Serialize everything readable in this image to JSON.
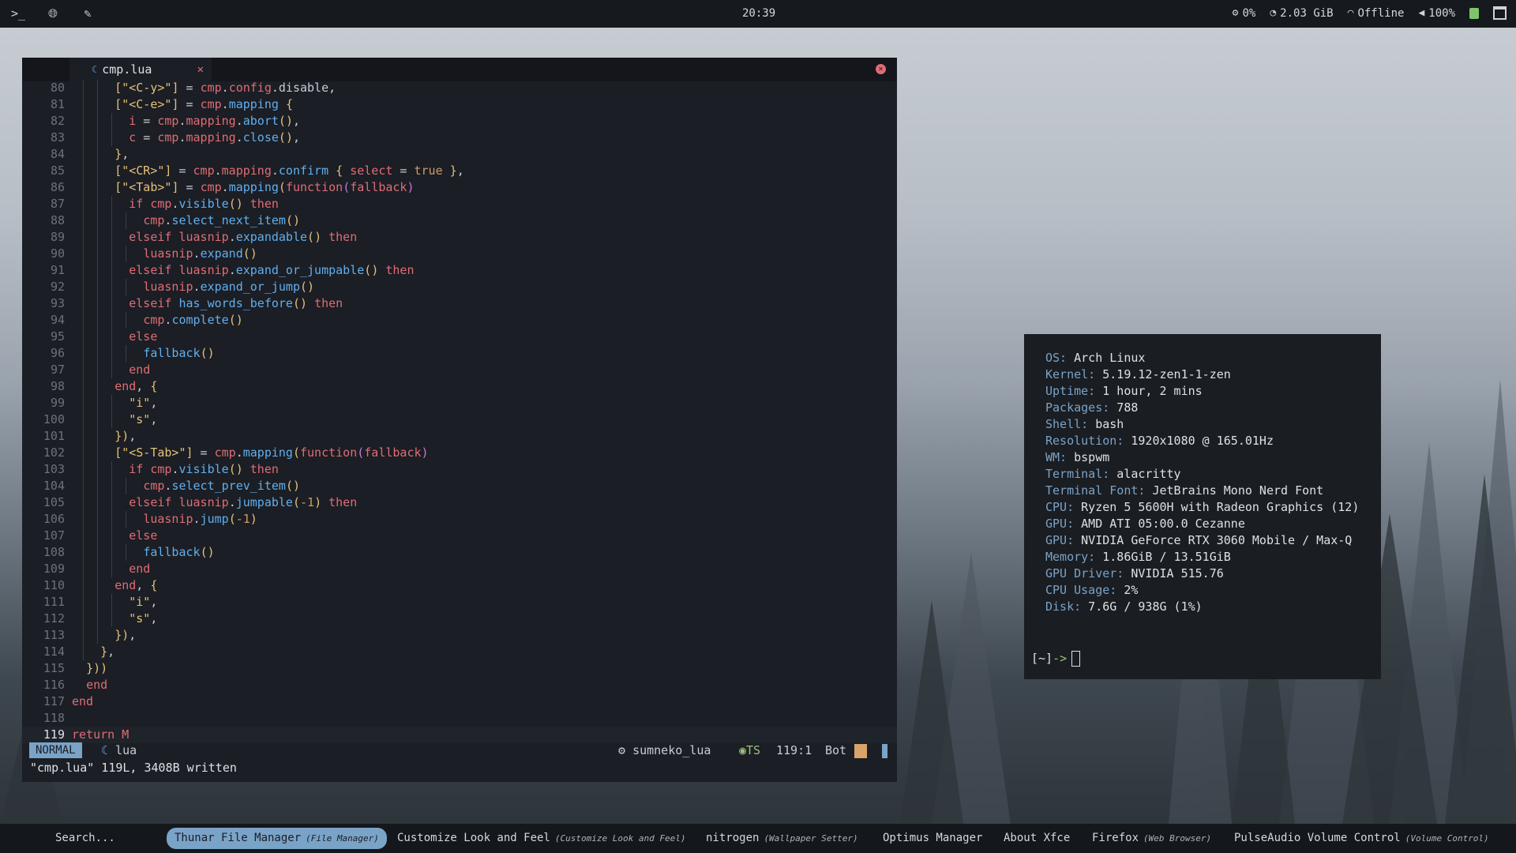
{
  "topbar": {
    "clock": "20:39",
    "cpu": "0%",
    "mem": "2.03 GiB",
    "net": "Offline",
    "vol": "100%"
  },
  "editor": {
    "tab_name": "cmp.lua",
    "mode": "NORMAL",
    "filetype": "lua",
    "lsp": "sumneko_lua",
    "ts": "TS",
    "position": "119:1",
    "scroll": "Bot",
    "message": "\"cmp.lua\" 119L, 3408B written",
    "lines": [
      {
        "n": "80",
        "t": "      [\"<C-y>\"] = cmp.config.disable,"
      },
      {
        "n": "81",
        "t": "      [\"<C-e>\"] = cmp.mapping {"
      },
      {
        "n": "82",
        "t": "        i = cmp.mapping.abort(),"
      },
      {
        "n": "83",
        "t": "        c = cmp.mapping.close(),"
      },
      {
        "n": "84",
        "t": "      },"
      },
      {
        "n": "85",
        "t": "      [\"<CR>\"] = cmp.mapping.confirm { select = true },"
      },
      {
        "n": "86",
        "t": "      [\"<Tab>\"] = cmp.mapping(function(fallback)"
      },
      {
        "n": "87",
        "t": "        if cmp.visible() then"
      },
      {
        "n": "88",
        "t": "          cmp.select_next_item()"
      },
      {
        "n": "89",
        "t": "        elseif luasnip.expandable() then"
      },
      {
        "n": "90",
        "t": "          luasnip.expand()"
      },
      {
        "n": "91",
        "t": "        elseif luasnip.expand_or_jumpable() then"
      },
      {
        "n": "92",
        "t": "          luasnip.expand_or_jump()"
      },
      {
        "n": "93",
        "t": "        elseif has_words_before() then"
      },
      {
        "n": "94",
        "t": "          cmp.complete()"
      },
      {
        "n": "95",
        "t": "        else"
      },
      {
        "n": "96",
        "t": "          fallback()"
      },
      {
        "n": "97",
        "t": "        end"
      },
      {
        "n": "98",
        "t": "      end, {"
      },
      {
        "n": "99",
        "t": "        \"i\","
      },
      {
        "n": "100",
        "t": "        \"s\","
      },
      {
        "n": "101",
        "t": "      }),"
      },
      {
        "n": "102",
        "t": "      [\"<S-Tab>\"] = cmp.mapping(function(fallback)"
      },
      {
        "n": "103",
        "t": "        if cmp.visible() then"
      },
      {
        "n": "104",
        "t": "          cmp.select_prev_item()"
      },
      {
        "n": "105",
        "t": "        elseif luasnip.jumpable(-1) then"
      },
      {
        "n": "106",
        "t": "          luasnip.jump(-1)"
      },
      {
        "n": "107",
        "t": "        else"
      },
      {
        "n": "108",
        "t": "          fallback()"
      },
      {
        "n": "109",
        "t": "        end"
      },
      {
        "n": "110",
        "t": "      end, {"
      },
      {
        "n": "111",
        "t": "        \"i\","
      },
      {
        "n": "112",
        "t": "        \"s\","
      },
      {
        "n": "113",
        "t": "      }),"
      },
      {
        "n": "114",
        "t": "    },"
      },
      {
        "n": "115",
        "t": "  }))"
      },
      {
        "n": "116",
        "t": "  end"
      },
      {
        "n": "117",
        "t": "end"
      },
      {
        "n": "118",
        "t": ""
      },
      {
        "n": "119",
        "t": "return M"
      }
    ]
  },
  "terminal": {
    "info": [
      {
        "label": "OS:",
        "value": " Arch Linux"
      },
      {
        "label": "Kernel:",
        "value": " 5.19.12-zen1-1-zen"
      },
      {
        "label": "Uptime:",
        "value": " 1 hour, 2 mins"
      },
      {
        "label": "Packages:",
        "value": " 788"
      },
      {
        "label": "Shell:",
        "value": " bash"
      },
      {
        "label": "Resolution:",
        "value": " 1920x1080 @ 165.01Hz"
      },
      {
        "label": "WM:",
        "value": " bspwm"
      },
      {
        "label": "Terminal:",
        "value": " alacritty"
      },
      {
        "label": "Terminal Font:",
        "value": " JetBrains Mono Nerd Font"
      },
      {
        "label": "CPU:",
        "value": " Ryzen 5 5600H with Radeon Graphics (12)"
      },
      {
        "label": "GPU:",
        "value": " AMD ATI 05:00.0 Cezanne"
      },
      {
        "label": "GPU:",
        "value": " NVIDIA GeForce RTX 3060 Mobile / Max-Q"
      },
      {
        "label": "Memory:",
        "value": " 1.86GiB / 13.51GiB"
      },
      {
        "label": "GPU Driver:",
        "value": " NVIDIA 515.76"
      },
      {
        "label": "CPU Usage:",
        "value": " 2%"
      },
      {
        "label": "Disk:",
        "value": " 7.6G / 938G (1%)"
      }
    ],
    "prompt_dir": "[~]",
    "prompt_arrow": "->"
  },
  "taskbar": {
    "search": "Search...",
    "tasks": [
      {
        "name": "Thunar File Manager",
        "sub": "(File Manager)"
      },
      {
        "name": "Customize Look and Feel",
        "sub": "(Customize Look and Feel)"
      },
      {
        "name": "nitrogen",
        "sub": "(Wallpaper Setter)"
      },
      {
        "name": "Optimus Manager",
        "sub": ""
      },
      {
        "name": "About Xfce",
        "sub": ""
      },
      {
        "name": "Firefox",
        "sub": "(Web Browser)"
      },
      {
        "name": "PulseAudio Volume Control",
        "sub": "(Volume Control)"
      }
    ]
  }
}
